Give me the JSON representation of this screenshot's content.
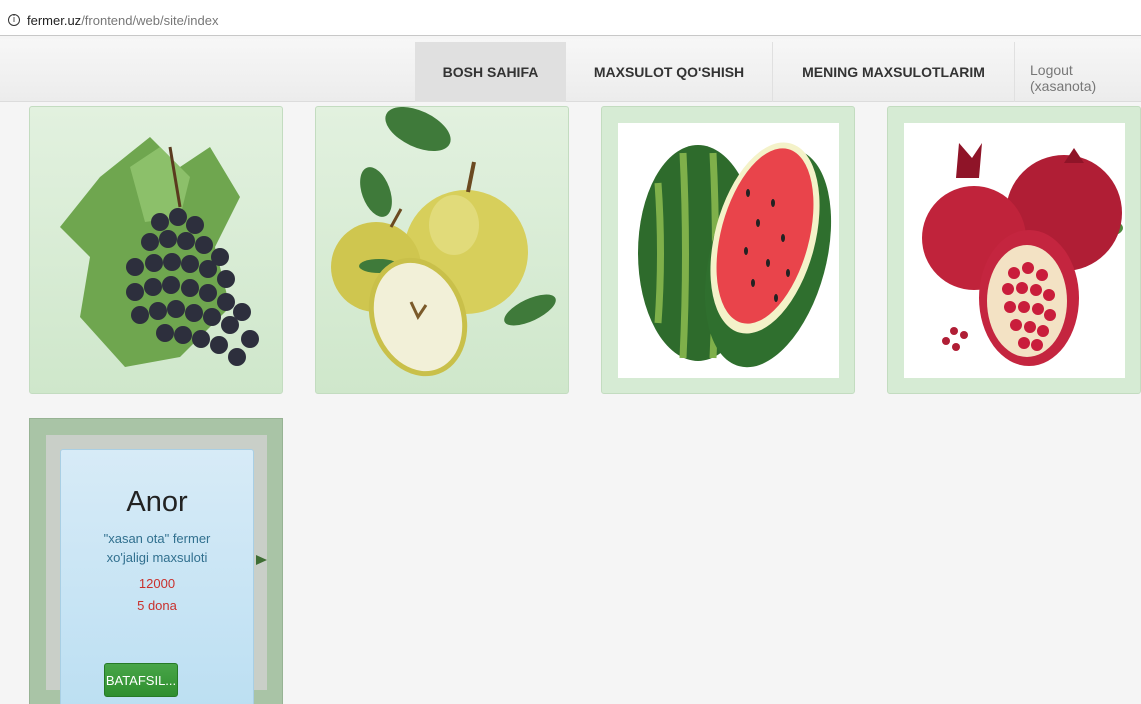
{
  "browser": {
    "url_domain": "fermer.uz",
    "url_path": "/frontend/web/site/index"
  },
  "nav": {
    "home": "BOSH SAHIFA",
    "add_product": "MAXSULOT QO'SHISH",
    "my_products": "MENING MAXSULOTLARIM",
    "logout": "Logout (xasanota)"
  },
  "products": [
    {
      "image": "grapes-image"
    },
    {
      "image": "apples-image"
    },
    {
      "image": "watermelon-image"
    },
    {
      "image": "pomegranate-image"
    }
  ],
  "featured": {
    "title": "Anor",
    "description": "\"xasan ota\" fermer xo'jaligi maxsuloti",
    "price": "12000",
    "quantity": "5 dona",
    "button": "BATAFSIL..."
  },
  "colors": {
    "card_green": "#d6ebd4",
    "button_green": "#3c9a3c",
    "price_red": "#c9302c",
    "desc_blue": "#31708f"
  }
}
